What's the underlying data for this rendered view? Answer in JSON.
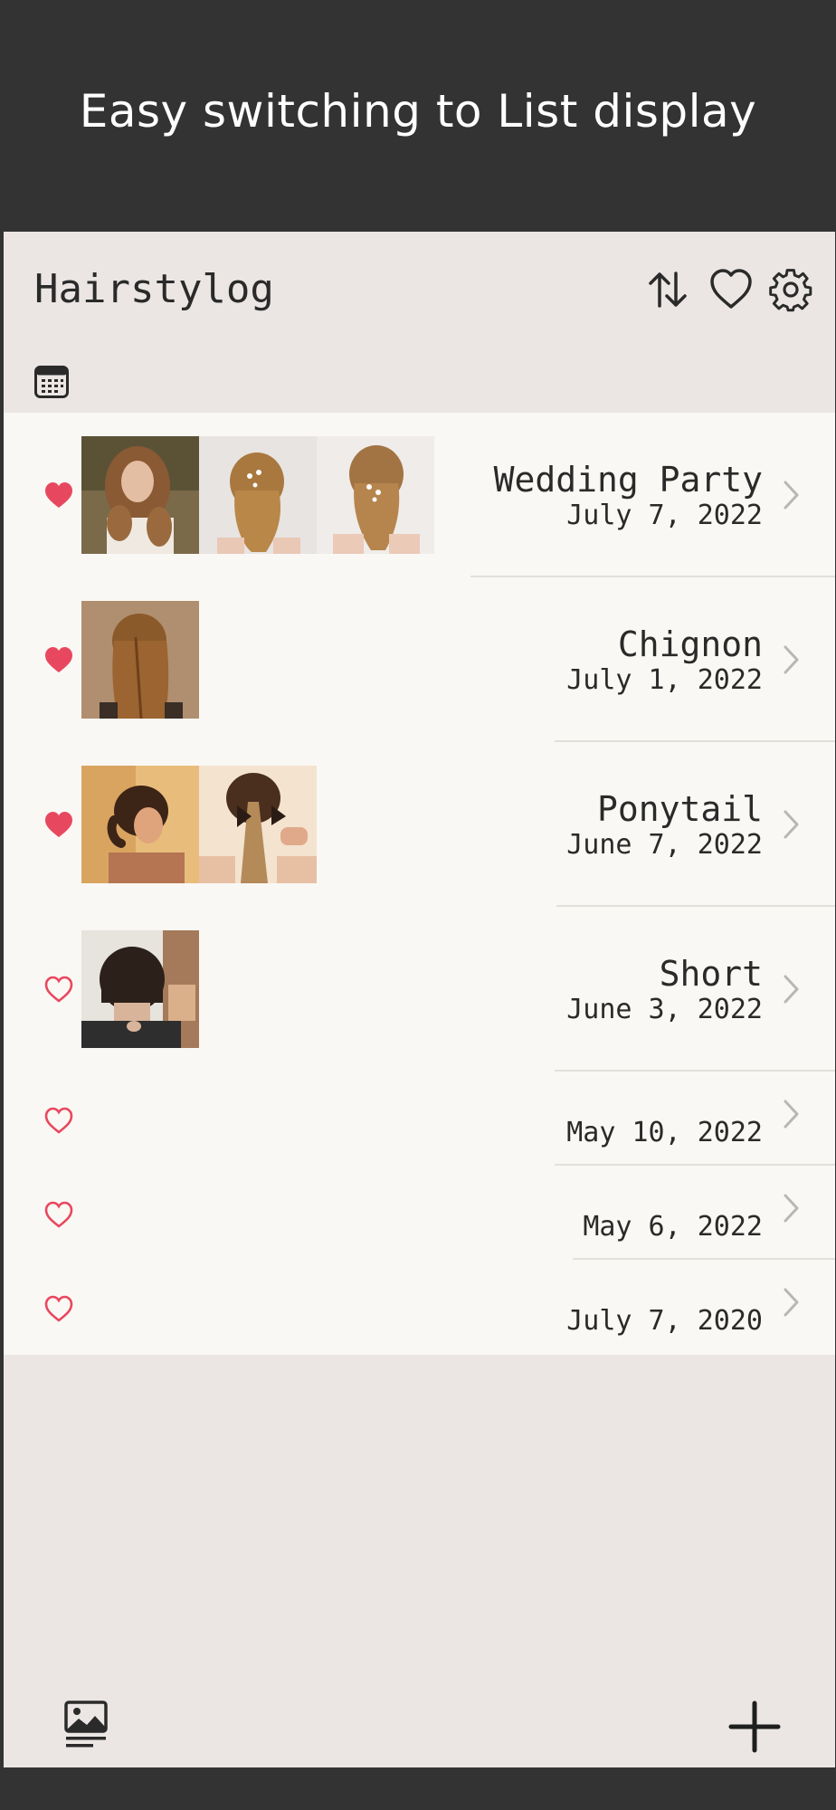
{
  "banner": {
    "text": "Easy switching to List display"
  },
  "app": {
    "title": "Hairstylog"
  },
  "header_icons": [
    "sort-icon",
    "heart-outline-icon",
    "gear-icon"
  ],
  "colors": {
    "heart": "#e8485f",
    "banner_bg": "#333333",
    "screen_bg": "#ebe6e4",
    "list_bg": "#faf8f4"
  },
  "entries": [
    {
      "title": "Wedding Party",
      "date": "July 7, 2022",
      "favorite": true,
      "photos": 3
    },
    {
      "title": "Chignon",
      "date": "July 1, 2022",
      "favorite": true,
      "photos": 1
    },
    {
      "title": "Ponytail",
      "date": "June 7, 2022",
      "favorite": true,
      "photos": 2
    },
    {
      "title": "Short",
      "date": "June 3, 2022",
      "favorite": false,
      "photos": 1
    },
    {
      "title": "",
      "date": "May 10, 2022",
      "favorite": false,
      "photos": 0
    },
    {
      "title": "",
      "date": "May 6, 2022",
      "favorite": false,
      "photos": 0
    },
    {
      "title": "",
      "date": "July 7, 2020",
      "favorite": false,
      "photos": 0
    }
  ],
  "toolbar": {
    "left_icon": "gallery-view-icon",
    "right_icon": "add-icon"
  }
}
